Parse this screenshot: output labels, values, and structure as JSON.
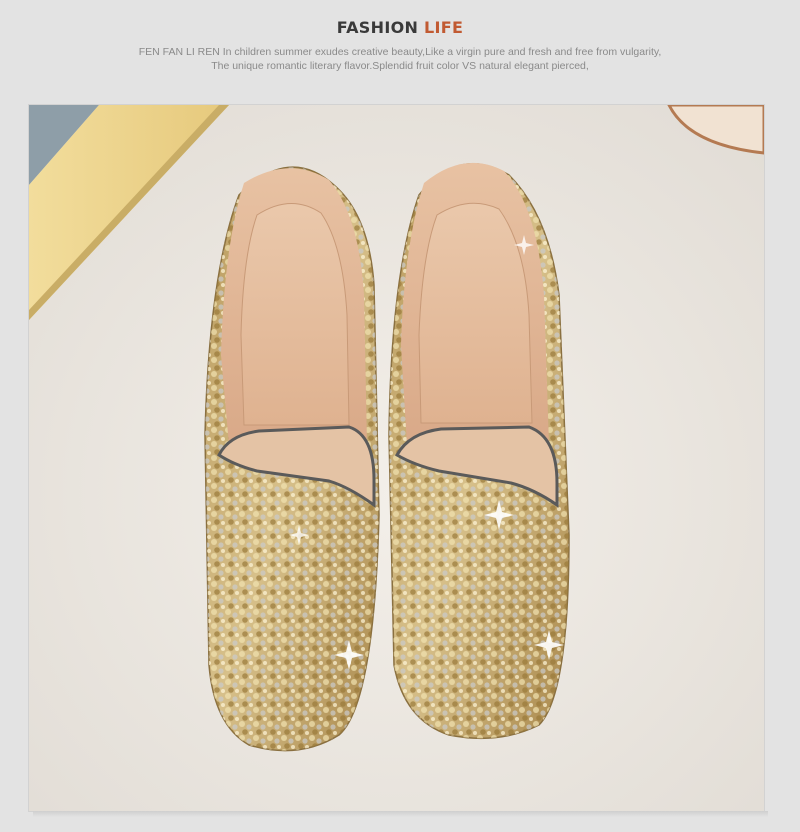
{
  "header": {
    "title_main": "FASHION ",
    "title_accent": "LIFE",
    "subtitle_line1": "FEN FAN LI REN In children summer exudes creative beauty,Like a virgin pure and fresh and free from vulgarity,",
    "subtitle_line2": "The unique romantic literary flavor.Splendid fruit color VS natural elegant pierced,"
  },
  "colors": {
    "accent": "#c15a32",
    "title": "#3a3a3a",
    "subtitle": "#8a8a8a",
    "background": "#e3e3e3",
    "sequin_gold": "#c8a45a",
    "sequin_silver": "#d8d8d8",
    "lining": "#e9c4a6"
  }
}
